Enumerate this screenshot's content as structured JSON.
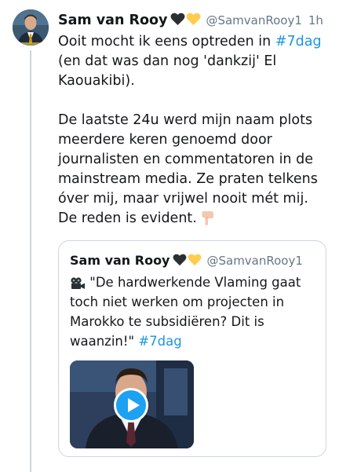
{
  "tweet": {
    "display_name": "Sam van Rooy",
    "handle": "@SamvanRooy1",
    "time": "1h",
    "emojis": [
      "black-heart-icon",
      "yellow-heart-icon"
    ],
    "text_lines": [
      {
        "before": "Ooit mocht ik eens optreden in ",
        "hashtag": "#7dag"
      },
      {
        "before": "(en dat was dan nog 'dankzij' El"
      },
      {
        "before": "Kaouakibi)."
      },
      {
        "gap": true
      },
      {
        "before": "De laatste 24u werd mijn naam plots"
      },
      {
        "before": "meerdere keren genoemd door"
      },
      {
        "before": "journalisten en commentatoren in de"
      },
      {
        "before": "mainstream media. Ze praten telkens"
      },
      {
        "before": "óver mij, maar vrijwel nooit mét mij."
      },
      {
        "before": "De reden is evident. ",
        "emoji": "backhand-index-pointing-down-icon"
      }
    ]
  },
  "quote": {
    "display_name": "Sam van Rooy",
    "handle": "@SamvanRooy1",
    "line1": "\"De hardwerkende Vlaming gaat",
    "line2": "toch niet werken om projecten in",
    "line3": "Marokko te subsidiëren? Dit is",
    "line4": "waanzin!\" ",
    "hashtag": "#7dag",
    "video_has_play_button": true
  },
  "colors": {
    "hashtag": "#1b95e0",
    "secondary_text": "#657786",
    "play_button": "#1da1f2",
    "border": "#ccd6dd"
  }
}
